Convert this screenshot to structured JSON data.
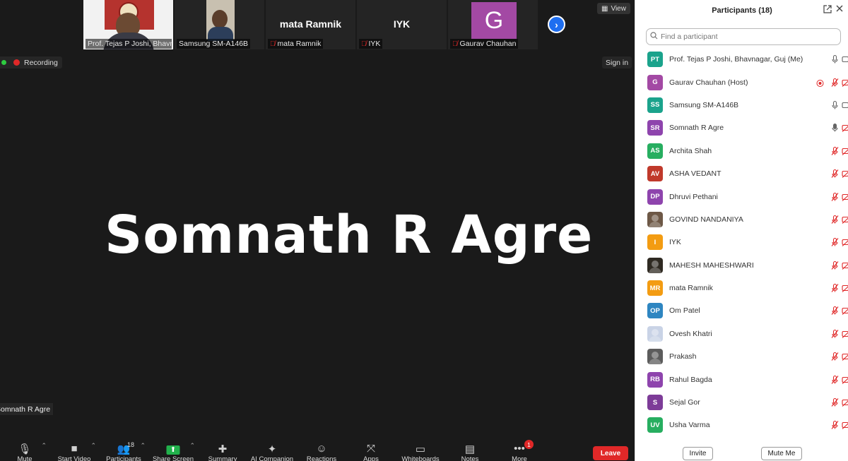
{
  "meeting": {
    "thumbnails": [
      {
        "name": "Prof. Tejas P Joshi, Bhavna...",
        "muted": false,
        "kind": "video1"
      },
      {
        "name": "Samsung SM-A146B",
        "muted": false,
        "kind": "video2"
      },
      {
        "name": "mata Ramnik",
        "center": "mata Ramnik",
        "muted": true,
        "kind": "text"
      },
      {
        "name": "IYK",
        "center": "IYK",
        "muted": true,
        "kind": "text"
      },
      {
        "name": "Gaurav Chauhan",
        "center": "G",
        "muted": true,
        "kind": "letter"
      }
    ],
    "view_label": "View",
    "recording_label": "Recording",
    "signin_label": "Sign in",
    "active_speaker": "Somnath R Agre",
    "active_label": "Somnath R Agre"
  },
  "toolbar": {
    "buttons": [
      {
        "icon": "mic-icon",
        "glyph": "🎙",
        "label": "Mute",
        "caret": true
      },
      {
        "icon": "video-icon",
        "glyph": "■",
        "label": "Start Video",
        "caret": true
      },
      {
        "icon": "participants-icon",
        "glyph": "👥",
        "label": "Participants",
        "caret": true,
        "count": "18"
      },
      {
        "icon": "share-screen-icon",
        "glyph": "⬆",
        "label": "Share Screen",
        "caret": true
      },
      {
        "icon": "summary-icon",
        "glyph": "✚",
        "label": "Summary",
        "caret": false
      },
      {
        "icon": "ai-companion-icon",
        "glyph": "✦",
        "label": "AI Companion",
        "caret": false
      },
      {
        "icon": "reactions-icon",
        "glyph": "☺",
        "label": "Reactions",
        "caret": false
      },
      {
        "icon": "apps-icon",
        "glyph": "⤧",
        "label": "Apps",
        "caret": false
      },
      {
        "icon": "whiteboards-icon",
        "glyph": "▭",
        "label": "Whiteboards",
        "caret": false
      },
      {
        "icon": "notes-icon",
        "glyph": "▤",
        "label": "Notes",
        "caret": false
      },
      {
        "icon": "more-icon",
        "glyph": "•••",
        "label": "More",
        "caret": false,
        "badge": "1"
      }
    ],
    "leave_label": "Leave"
  },
  "panel": {
    "title": "Participants (18)",
    "search_placeholder": "Find a participant",
    "participants": [
      {
        "initials": "PT",
        "color": "#1ba38c",
        "name": "Prof. Tejas P Joshi, Bhavnagar, Guj (Me)",
        "mic": "on",
        "cam": "on",
        "host": false
      },
      {
        "initials": "G",
        "color": "#a349a4",
        "name": "Gaurav Chauhan (Host)",
        "mic": "off",
        "cam": "off",
        "host": true
      },
      {
        "initials": "SS",
        "color": "#1ba38c",
        "name": "Samsung SM-A146B",
        "mic": "on",
        "cam": "on",
        "host": false
      },
      {
        "initials": "SR",
        "color": "#8e44ad",
        "name": "Somnath R Agre",
        "mic": "talking",
        "cam": "off",
        "host": false
      },
      {
        "initials": "AS",
        "color": "#27ae60",
        "name": "Archita Shah",
        "mic": "off",
        "cam": "off",
        "host": false
      },
      {
        "initials": "AV",
        "color": "#c0392b",
        "name": "ASHA VEDANT",
        "mic": "off",
        "cam": "off",
        "host": false
      },
      {
        "initials": "DP",
        "color": "#8e44ad",
        "name": "Dhruvi Pethani",
        "mic": "off",
        "cam": "off",
        "host": false
      },
      {
        "initials": "",
        "color": "#6d5846",
        "name": "GOVIND NANDANIYA",
        "mic": "off",
        "cam": "off",
        "host": false,
        "photo": true
      },
      {
        "initials": "I",
        "color": "#f39c12",
        "name": "IYK",
        "mic": "off",
        "cam": "off",
        "host": false
      },
      {
        "initials": "",
        "color": "#2f2a22",
        "name": "MAHESH MAHESHWARI",
        "mic": "off",
        "cam": "off",
        "host": false,
        "photo": true
      },
      {
        "initials": "MR",
        "color": "#f39c12",
        "name": "mata Ramnik",
        "mic": "off",
        "cam": "off",
        "host": false
      },
      {
        "initials": "OP",
        "color": "#2e86c1",
        "name": "Om Patel",
        "mic": "off",
        "cam": "off",
        "host": false
      },
      {
        "initials": "",
        "color": "#c9d3e6",
        "name": "Ovesh Khatri",
        "mic": "off",
        "cam": "off",
        "host": false,
        "photo": true
      },
      {
        "initials": "",
        "color": "#5c5c5c",
        "name": "Prakash",
        "mic": "off",
        "cam": "off",
        "host": false,
        "photo": true
      },
      {
        "initials": "RB",
        "color": "#8e44ad",
        "name": "Rahul Bagda",
        "mic": "off",
        "cam": "off",
        "host": false
      },
      {
        "initials": "S",
        "color": "#7d3c98",
        "name": "Sejal Gor",
        "mic": "off",
        "cam": "off",
        "host": false
      },
      {
        "initials": "UV",
        "color": "#27ae60",
        "name": "Usha Varma",
        "mic": "off",
        "cam": "off",
        "host": false
      }
    ],
    "invite_label": "Invite",
    "mute_me_label": "Mute Me"
  }
}
